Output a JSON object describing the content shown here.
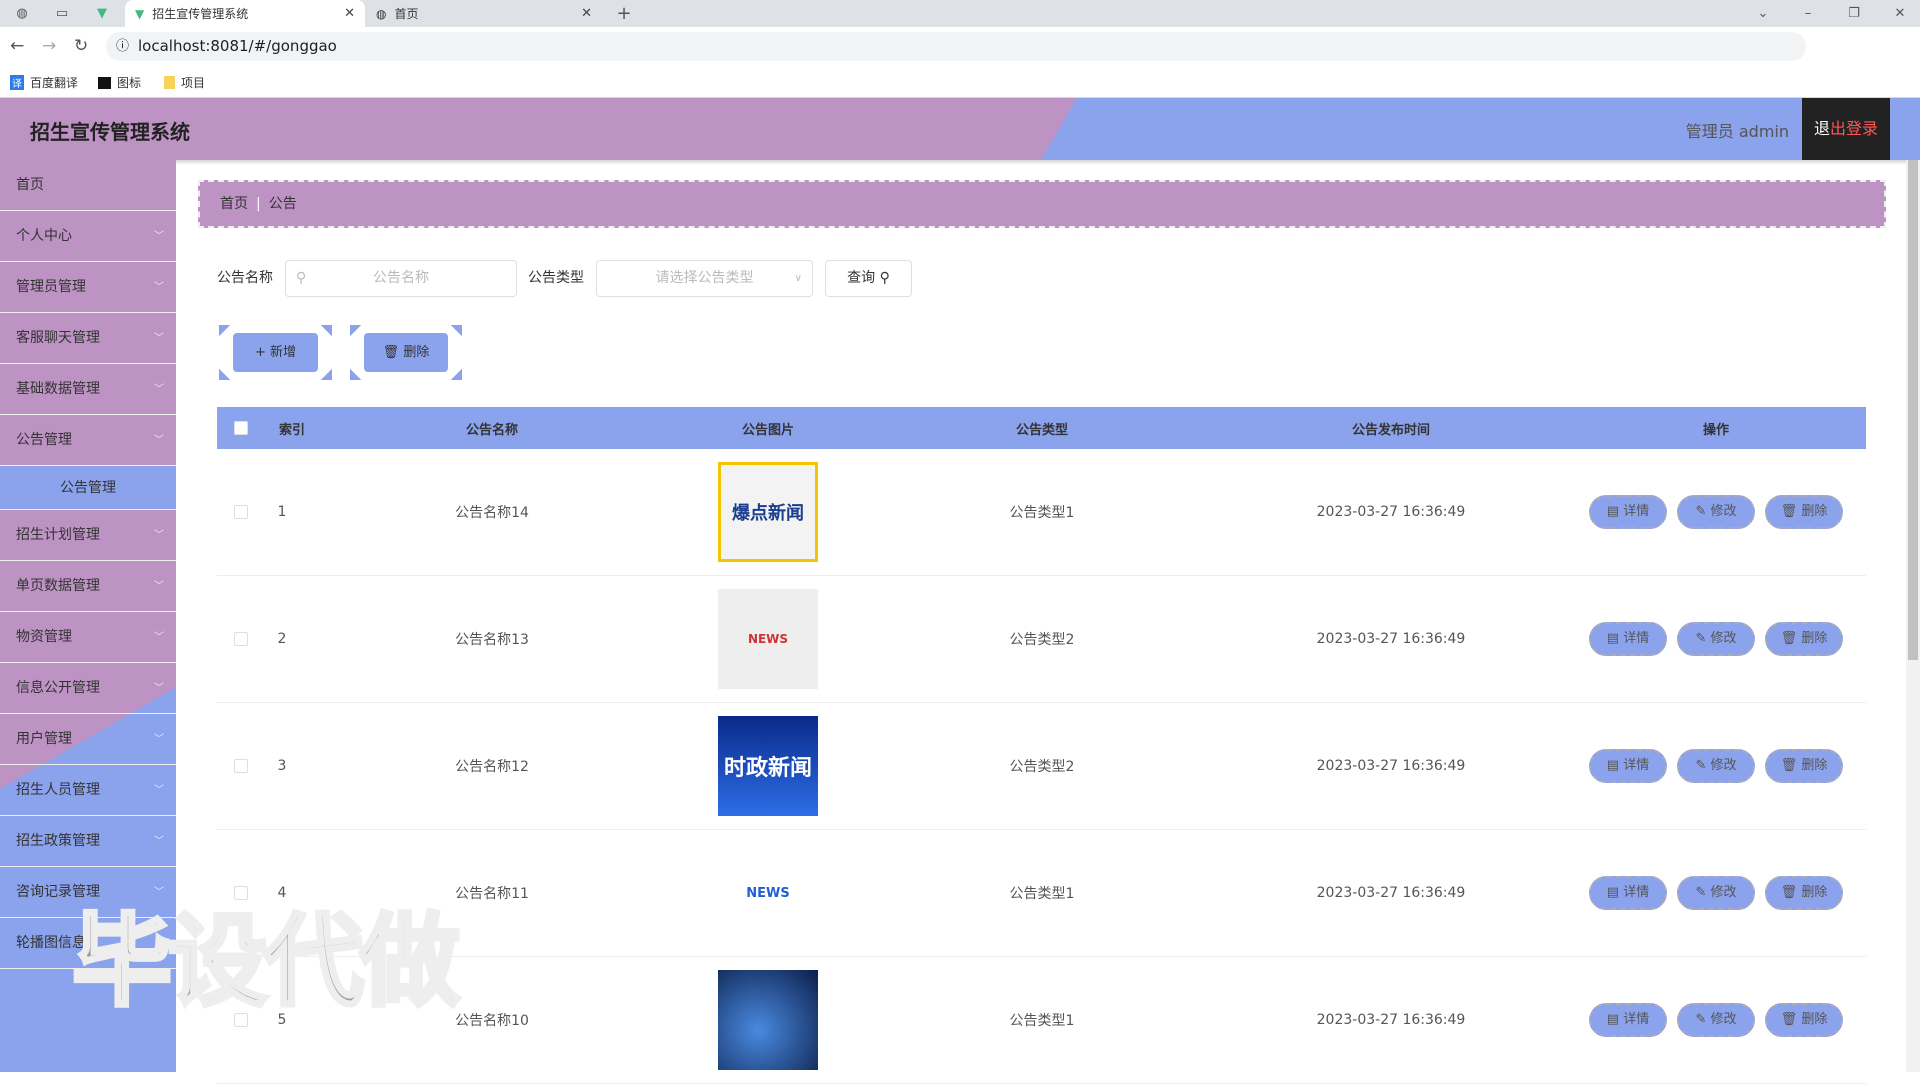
{
  "browser": {
    "tabs": [
      {
        "title": "招生宣传管理系统"
      },
      {
        "title": "首页"
      }
    ],
    "url": "localhost:8081/#/gonggao",
    "bookmarks": [
      "百度翻译",
      "图标",
      "项目"
    ]
  },
  "header": {
    "title": "招生宣传管理系统",
    "user": "管理员 admin",
    "logout_a": "退",
    "logout_b": "出登录"
  },
  "sidebar": {
    "items": [
      "首页",
      "个人中心",
      "管理员管理",
      "客服聊天管理",
      "基础数据管理",
      "公告管理"
    ],
    "sub": "公告管理",
    "items2": [
      "招生计划管理",
      "单页数据管理",
      "物资管理",
      "信息公开管理",
      "用户管理",
      "招生人员管理",
      "招生政策管理",
      "咨询记录管理",
      "轮播图信息"
    ]
  },
  "breadcrumb": {
    "home": "首页",
    "current": "公告"
  },
  "search": {
    "name_label": "公告名称",
    "name_placeholder": "公告名称",
    "type_label": "公告类型",
    "type_placeholder": "请选择公告类型",
    "query": "查询"
  },
  "actions": {
    "add": "+ 新增",
    "delete": "删除"
  },
  "table": {
    "headers": [
      "索引",
      "公告名称",
      "公告图片",
      "公告类型",
      "公告发布时间",
      "操作"
    ],
    "rows": [
      {
        "index": "1",
        "name": "公告名称14",
        "image": "爆点新闻",
        "type": "公告类型1",
        "time": "2023-03-27 16:36:49"
      },
      {
        "index": "2",
        "name": "公告名称13",
        "image": "NEWS",
        "type": "公告类型2",
        "time": "2023-03-27 16:36:49"
      },
      {
        "index": "3",
        "name": "公告名称12",
        "image": "时政新闻",
        "type": "公告类型2",
        "time": "2023-03-27 16:36:49"
      },
      {
        "index": "4",
        "name": "公告名称11",
        "image": "NEWS",
        "type": "公告类型1",
        "time": "2023-03-27 16:36:49"
      },
      {
        "index": "5",
        "name": "公告名称10",
        "image": "",
        "type": "公告类型1",
        "time": "2023-03-27 16:36:49"
      }
    ],
    "ops": {
      "detail": "详情",
      "edit": "修改",
      "delete": "删除"
    }
  },
  "watermark": "毕设代做"
}
